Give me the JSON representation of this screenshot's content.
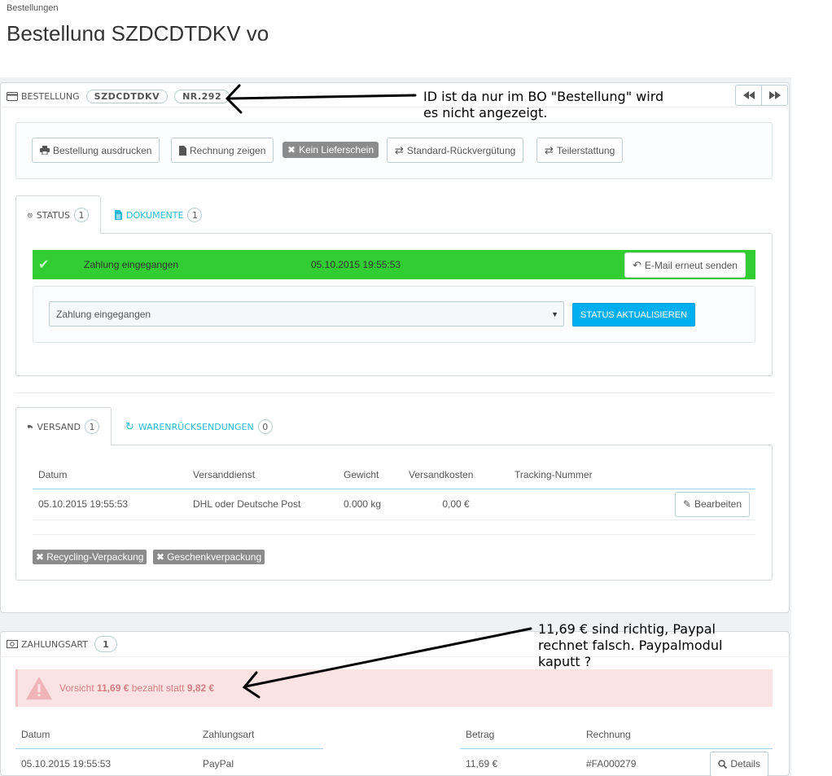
{
  "breadcrumb": "Bestellungen",
  "page_title": "Bestellung SZDCDTDKV vo",
  "order": {
    "heading_label": "BESTELLUNG",
    "reference": "SZDCDTDKV",
    "number": "NR.292",
    "actions": {
      "print": "Bestellung ausdrucken",
      "invoice": "Rechnung zeigen",
      "no_delivery": "Kein Lieferschein",
      "standard_refund": "Standard-Rückvergütung",
      "partial_refund": "Teilerstattung"
    }
  },
  "status_tabs": [
    {
      "label": "STATUS",
      "count": "1"
    },
    {
      "label": "DOKUMENTE",
      "count": "1"
    }
  ],
  "status_row": {
    "state": "Zahlung eingegangen",
    "date": "05.10.2015 19:55:53",
    "resend_label": "E-Mail erneut senden",
    "bar_color": "#32cd32"
  },
  "status_select": {
    "value": "Zahlung eingegangen",
    "update_label": "STATUS AKTUALISIEREN"
  },
  "shipping_tabs": [
    {
      "label": "VERSAND",
      "count": "1"
    },
    {
      "label": "WARENRÜCKSENDUNGEN",
      "count": "0"
    }
  ],
  "shipping_table": {
    "headers": [
      "Datum",
      "Versanddienst",
      "Gewicht",
      "Versandkosten",
      "Tracking-Nummer"
    ],
    "row": [
      "05.10.2015 19:55:53",
      "DHL oder Deutsche Post",
      "0.000 kg",
      "0,00 €",
      ""
    ],
    "edit_label": "Bearbeiten"
  },
  "packaging": {
    "recycling": "Recycling-Verpackung",
    "gift": "Geschenkverpackung"
  },
  "payment": {
    "heading_label": "ZAHLUNGSART",
    "count": "1",
    "alert_prefix": "Vorsicht",
    "alert_paid": "11,69 €",
    "alert_middle": "bezahlt statt",
    "alert_expected": "9,82 €",
    "headers": [
      "Datum",
      "Zahlungsart",
      "Betrag",
      "Rechnung"
    ],
    "row": [
      "05.10.2015 19:55:53",
      "PayPal",
      "11,69 €",
      "#FA000279"
    ],
    "details_label": "Details"
  },
  "annotations": {
    "top_line1": "ID ist da nur im BO \"Bestellung\" wird",
    "top_line2": "es nicht angezeigt.",
    "bottom_line1": "11,69 € sind richtig, Paypal",
    "bottom_line2": "rechnet falsch. Paypalmodul",
    "bottom_line3": "kaputt ?"
  },
  "colors": {
    "accent": "#25b9d7",
    "primary_button": "#00aff0",
    "alert_bg": "#fbe3e4",
    "alert_text": "#d27c82"
  }
}
